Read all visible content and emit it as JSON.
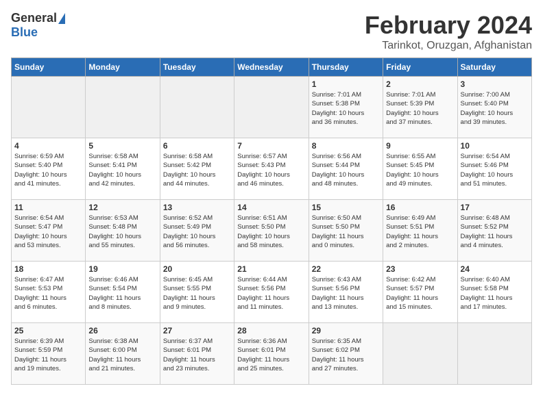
{
  "logo": {
    "general": "General",
    "blue": "Blue"
  },
  "header": {
    "month": "February 2024",
    "location": "Tarinkot, Oruzgan, Afghanistan"
  },
  "days_of_week": [
    "Sunday",
    "Monday",
    "Tuesday",
    "Wednesday",
    "Thursday",
    "Friday",
    "Saturday"
  ],
  "weeks": [
    [
      {
        "day": "",
        "info": ""
      },
      {
        "day": "",
        "info": ""
      },
      {
        "day": "",
        "info": ""
      },
      {
        "day": "",
        "info": ""
      },
      {
        "day": "1",
        "info": "Sunrise: 7:01 AM\nSunset: 5:38 PM\nDaylight: 10 hours\nand 36 minutes."
      },
      {
        "day": "2",
        "info": "Sunrise: 7:01 AM\nSunset: 5:39 PM\nDaylight: 10 hours\nand 37 minutes."
      },
      {
        "day": "3",
        "info": "Sunrise: 7:00 AM\nSunset: 5:40 PM\nDaylight: 10 hours\nand 39 minutes."
      }
    ],
    [
      {
        "day": "4",
        "info": "Sunrise: 6:59 AM\nSunset: 5:40 PM\nDaylight: 10 hours\nand 41 minutes."
      },
      {
        "day": "5",
        "info": "Sunrise: 6:58 AM\nSunset: 5:41 PM\nDaylight: 10 hours\nand 42 minutes."
      },
      {
        "day": "6",
        "info": "Sunrise: 6:58 AM\nSunset: 5:42 PM\nDaylight: 10 hours\nand 44 minutes."
      },
      {
        "day": "7",
        "info": "Sunrise: 6:57 AM\nSunset: 5:43 PM\nDaylight: 10 hours\nand 46 minutes."
      },
      {
        "day": "8",
        "info": "Sunrise: 6:56 AM\nSunset: 5:44 PM\nDaylight: 10 hours\nand 48 minutes."
      },
      {
        "day": "9",
        "info": "Sunrise: 6:55 AM\nSunset: 5:45 PM\nDaylight: 10 hours\nand 49 minutes."
      },
      {
        "day": "10",
        "info": "Sunrise: 6:54 AM\nSunset: 5:46 PM\nDaylight: 10 hours\nand 51 minutes."
      }
    ],
    [
      {
        "day": "11",
        "info": "Sunrise: 6:54 AM\nSunset: 5:47 PM\nDaylight: 10 hours\nand 53 minutes."
      },
      {
        "day": "12",
        "info": "Sunrise: 6:53 AM\nSunset: 5:48 PM\nDaylight: 10 hours\nand 55 minutes."
      },
      {
        "day": "13",
        "info": "Sunrise: 6:52 AM\nSunset: 5:49 PM\nDaylight: 10 hours\nand 56 minutes."
      },
      {
        "day": "14",
        "info": "Sunrise: 6:51 AM\nSunset: 5:50 PM\nDaylight: 10 hours\nand 58 minutes."
      },
      {
        "day": "15",
        "info": "Sunrise: 6:50 AM\nSunset: 5:50 PM\nDaylight: 11 hours\nand 0 minutes."
      },
      {
        "day": "16",
        "info": "Sunrise: 6:49 AM\nSunset: 5:51 PM\nDaylight: 11 hours\nand 2 minutes."
      },
      {
        "day": "17",
        "info": "Sunrise: 6:48 AM\nSunset: 5:52 PM\nDaylight: 11 hours\nand 4 minutes."
      }
    ],
    [
      {
        "day": "18",
        "info": "Sunrise: 6:47 AM\nSunset: 5:53 PM\nDaylight: 11 hours\nand 6 minutes."
      },
      {
        "day": "19",
        "info": "Sunrise: 6:46 AM\nSunset: 5:54 PM\nDaylight: 11 hours\nand 8 minutes."
      },
      {
        "day": "20",
        "info": "Sunrise: 6:45 AM\nSunset: 5:55 PM\nDaylight: 11 hours\nand 9 minutes."
      },
      {
        "day": "21",
        "info": "Sunrise: 6:44 AM\nSunset: 5:56 PM\nDaylight: 11 hours\nand 11 minutes."
      },
      {
        "day": "22",
        "info": "Sunrise: 6:43 AM\nSunset: 5:56 PM\nDaylight: 11 hours\nand 13 minutes."
      },
      {
        "day": "23",
        "info": "Sunrise: 6:42 AM\nSunset: 5:57 PM\nDaylight: 11 hours\nand 15 minutes."
      },
      {
        "day": "24",
        "info": "Sunrise: 6:40 AM\nSunset: 5:58 PM\nDaylight: 11 hours\nand 17 minutes."
      }
    ],
    [
      {
        "day": "25",
        "info": "Sunrise: 6:39 AM\nSunset: 5:59 PM\nDaylight: 11 hours\nand 19 minutes."
      },
      {
        "day": "26",
        "info": "Sunrise: 6:38 AM\nSunset: 6:00 PM\nDaylight: 11 hours\nand 21 minutes."
      },
      {
        "day": "27",
        "info": "Sunrise: 6:37 AM\nSunset: 6:01 PM\nDaylight: 11 hours\nand 23 minutes."
      },
      {
        "day": "28",
        "info": "Sunrise: 6:36 AM\nSunset: 6:01 PM\nDaylight: 11 hours\nand 25 minutes."
      },
      {
        "day": "29",
        "info": "Sunrise: 6:35 AM\nSunset: 6:02 PM\nDaylight: 11 hours\nand 27 minutes."
      },
      {
        "day": "",
        "info": ""
      },
      {
        "day": "",
        "info": ""
      }
    ]
  ]
}
